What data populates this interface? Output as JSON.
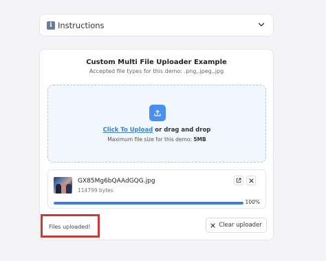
{
  "instructions": {
    "label": "Instructions",
    "icon": "info-icon"
  },
  "uploader": {
    "title": "Custom Multi File Uploader Example",
    "subtitle": "Accepted file types for this demo: .png,.jpeg,.jpg",
    "dropzone": {
      "link_text": "Click To Upload",
      "rest_text": " or drag and drop",
      "size_prefix": "Maximum file size for this demo: ",
      "size_value": "5MB"
    },
    "file": {
      "name": "GX85Mg6bQAAdGQG.jpg",
      "size": "114799 bytes",
      "progress": 100,
      "progress_label": "100%"
    },
    "status": "Files uploaded!",
    "clear_label": "Clear uploader"
  },
  "colors": {
    "accent": "#4a8ff0",
    "progress": "#3b7fe0",
    "highlight": "#c83a32"
  }
}
